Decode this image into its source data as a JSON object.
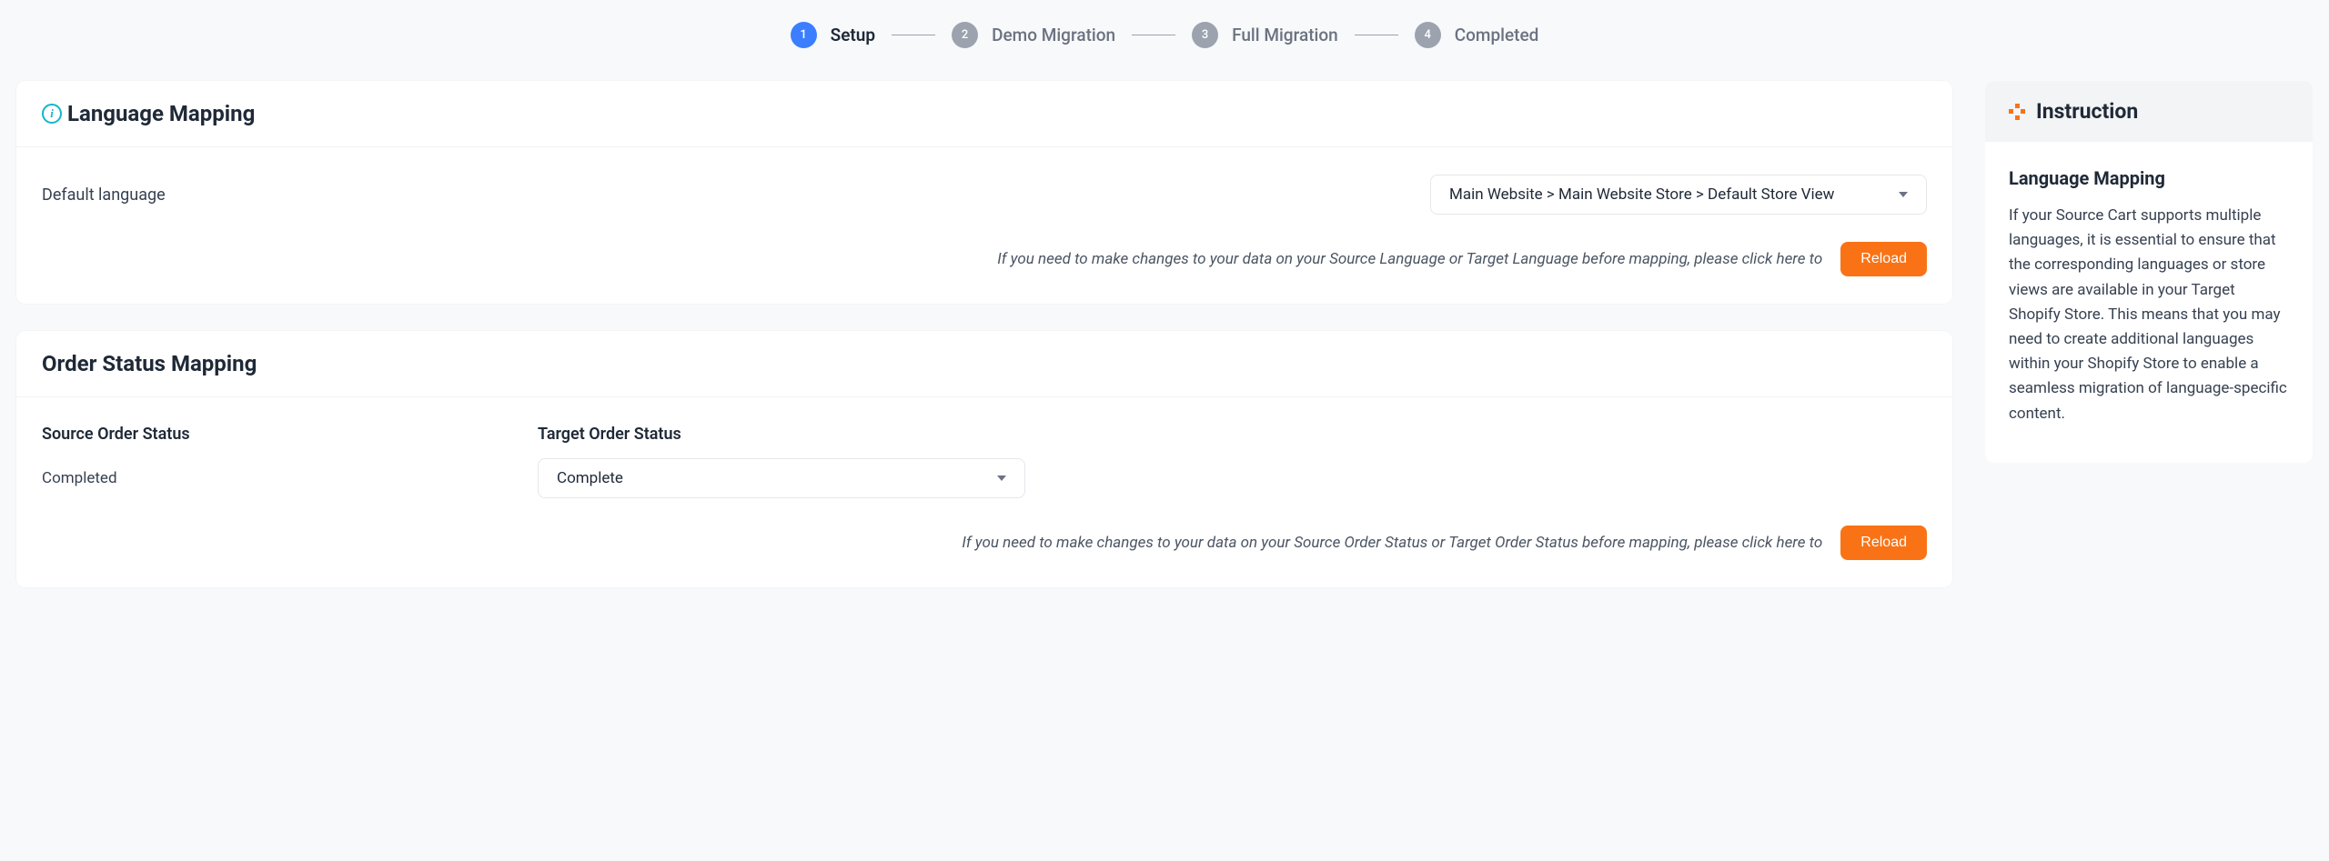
{
  "stepper": {
    "steps": [
      {
        "num": "1",
        "label": "Setup",
        "active": true
      },
      {
        "num": "2",
        "label": "Demo Migration",
        "active": false
      },
      {
        "num": "3",
        "label": "Full Migration",
        "active": false
      },
      {
        "num": "4",
        "label": "Completed",
        "active": false
      }
    ]
  },
  "language_mapping": {
    "title": "Language Mapping",
    "label": "Default language",
    "select_value": "Main Website > Main Website Store > Default Store View",
    "note": "If you need to make changes to your data on your Source Language or Target Language before mapping, please click here to",
    "reload": "Reload"
  },
  "order_status_mapping": {
    "title": "Order Status Mapping",
    "source_header": "Source Order Status",
    "target_header": "Target Order Status",
    "source_value": "Completed",
    "target_value": "Complete",
    "note": "If you need to make changes to your data on your Source Order Status or Target Order Status before mapping, please click here to",
    "reload": "Reload"
  },
  "instruction": {
    "title": "Instruction",
    "section_title": "Language Mapping",
    "body": "If your Source Cart supports multiple languages, it is essential to ensure that the corresponding languages or store views are available in your Target Shopify Store. This means that you may need to create additional languages within your Shopify Store to enable a seamless migration of language-specific content."
  }
}
